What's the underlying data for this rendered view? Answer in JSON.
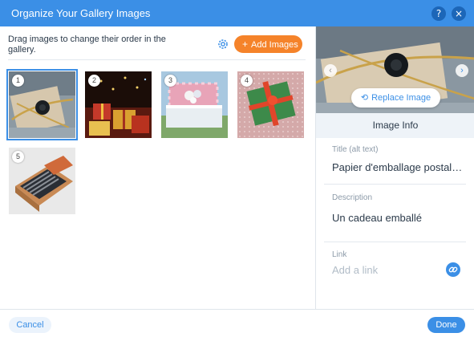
{
  "header": {
    "title": "Organize Your Gallery Images",
    "help_icon": "?",
    "close_icon": "×"
  },
  "gallery": {
    "instructions": "Drag images to change their order in the gallery.",
    "add_button": "Add Images",
    "add_icon": "+",
    "selected_index": 1,
    "thumbnails": [
      {
        "number": "1",
        "subject": "wrapped gift with gold ribbon"
      },
      {
        "number": "2",
        "subject": "gifts under christmas tree"
      },
      {
        "number": "3",
        "subject": "pink gift box with flowers"
      },
      {
        "number": "4",
        "subject": "green wrapped gift with red ribbon"
      },
      {
        "number": "5",
        "subject": "box of pencils"
      }
    ]
  },
  "details": {
    "replace_button": "Replace Image",
    "nav_prev": "‹",
    "nav_next": "›",
    "info_title": "Image Info",
    "title_label": "Title (alt text)",
    "title_value": "Papier d'emballage postal…",
    "description_label": "Description",
    "description_value": "Un cadeau emballé",
    "link_label": "Link",
    "link_placeholder": "Add a link"
  },
  "footer": {
    "cancel": "Cancel",
    "done": "Done"
  },
  "colors": {
    "accent": "#3b8fe6",
    "add_button": "#f5832a"
  }
}
